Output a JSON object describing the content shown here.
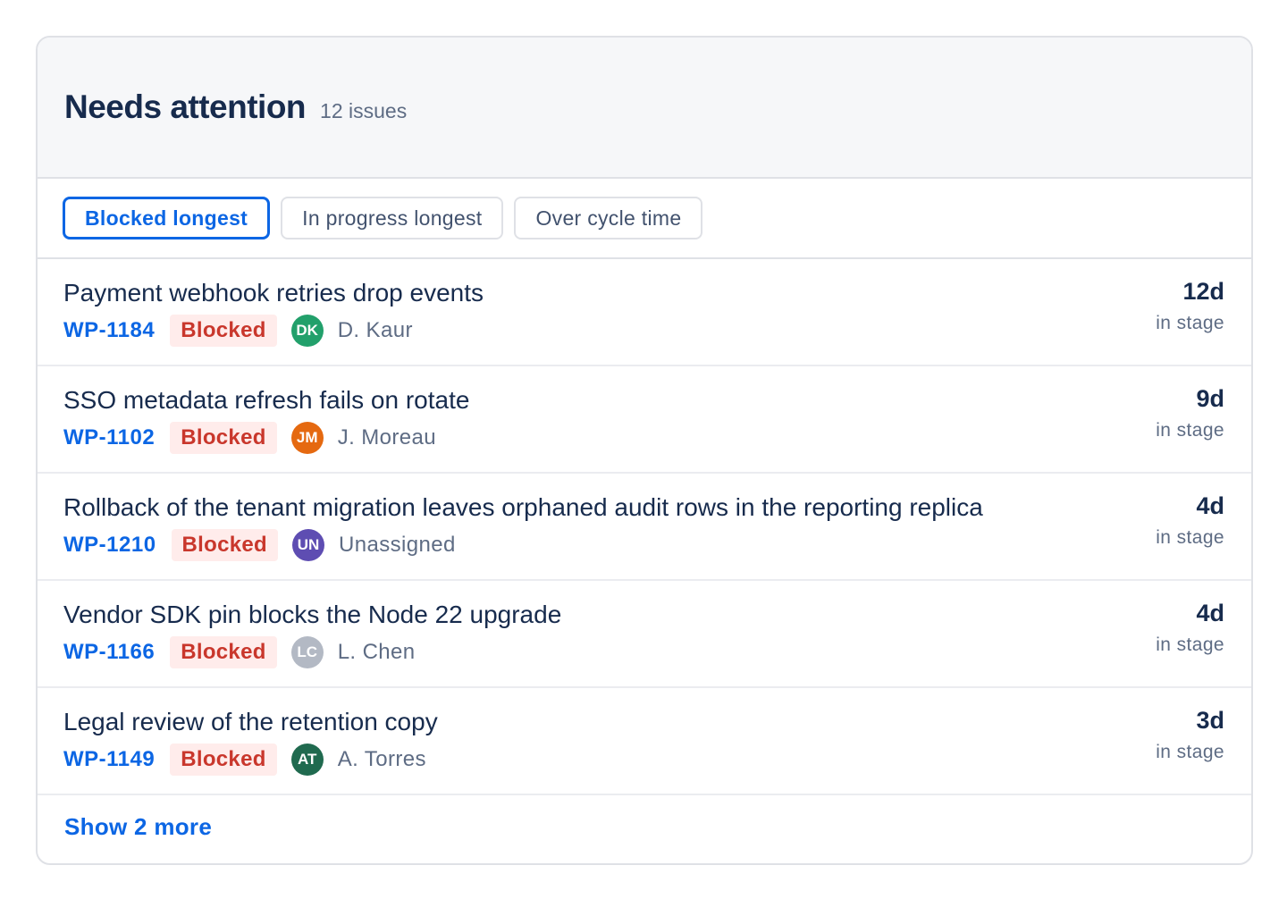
{
  "header": {
    "title": "Needs attention",
    "count": "12 issues"
  },
  "filters": [
    {
      "label": "Blocked longest",
      "active": true
    },
    {
      "label": "In progress longest",
      "active": false
    },
    {
      "label": "Over cycle time",
      "active": false
    }
  ],
  "issues": [
    {
      "title": "Payment webhook retries drop events",
      "key": "WP-1184",
      "status": "Blocked",
      "initials": "DK",
      "avatar_color": "#22a06b",
      "assignee": "D. Kaur",
      "duration": "12d",
      "duration_label": "in stage"
    },
    {
      "title": "SSO metadata refresh fails on rotate",
      "key": "WP-1102",
      "status": "Blocked",
      "initials": "JM",
      "avatar_color": "#e56910",
      "assignee": "J. Moreau",
      "duration": "9d",
      "duration_label": "in stage"
    },
    {
      "title": "Rollback of the tenant migration leaves orphaned audit rows in the reporting replica",
      "key": "WP-1210",
      "status": "Blocked",
      "initials": "UN",
      "avatar_color": "#5e4db2",
      "assignee": "Unassigned",
      "duration": "4d",
      "duration_label": "in stage"
    },
    {
      "title": "Vendor SDK pin blocks the Node 22 upgrade",
      "key": "WP-1166",
      "status": "Blocked",
      "initials": "LC",
      "avatar_color": "#b3b9c4",
      "assignee": "L. Chen",
      "duration": "4d",
      "duration_label": "in stage"
    },
    {
      "title": "Legal review of the retention copy",
      "key": "WP-1149",
      "status": "Blocked",
      "initials": "AT",
      "avatar_color": "#206a4f",
      "assignee": "A. Torres",
      "duration": "3d",
      "duration_label": "in stage"
    }
  ],
  "footer": {
    "show_more": "Show 2 more"
  },
  "colors": {
    "accent": "#0c66e4",
    "blocked_text": "#c9372c",
    "blocked_bg": "#ffeceb"
  }
}
